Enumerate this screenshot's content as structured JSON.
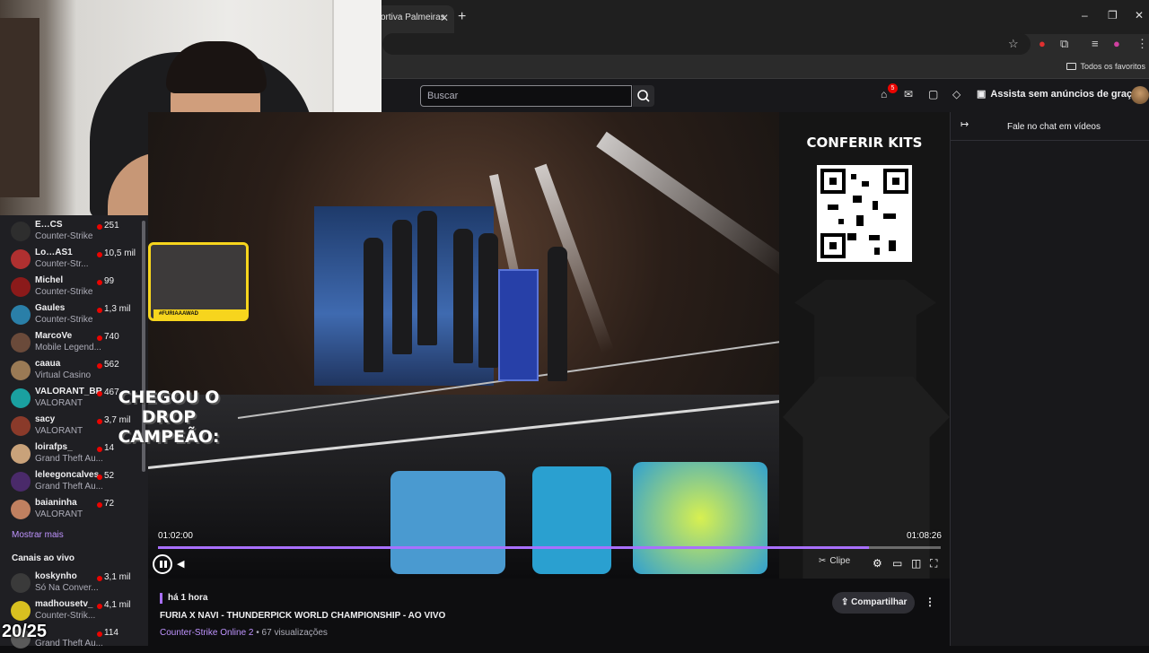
{
  "browser": {
    "tab_title": "ortiva Palmeiras",
    "tab_close": "✕",
    "new_tab": "+",
    "window_controls": [
      "–",
      "❐",
      "✕"
    ],
    "bookmarks_all": "Todos os favoritos"
  },
  "topnav": {
    "search_placeholder": "Buscar",
    "notifications_count": "5",
    "ad_free_label": "Assista sem anúncios de graça",
    "icons": [
      "search-icon",
      "prime-icon",
      "mail-icon",
      "whispers-icon",
      "crown-icon"
    ]
  },
  "sidebar": {
    "followed": [
      {
        "name": "E…CS",
        "game": "Counter-Strike",
        "viewers": "251",
        "color": "#2e2e2e"
      },
      {
        "name": "Lo…AS1",
        "game": "Counter-Str...",
        "viewers": "10,5 mil",
        "color": "#b03030"
      },
      {
        "name": "Michel",
        "game": "Counter-Strike",
        "viewers": "99",
        "color": "#8b1a1a"
      },
      {
        "name": "Gaules",
        "game": "Counter-Strike",
        "viewers": "1,3 mil",
        "color": "#2a7fa8"
      },
      {
        "name": "MarcoVe",
        "game": "Mobile Legend...",
        "viewers": "740",
        "color": "#6a4a3a"
      },
      {
        "name": "caaua",
        "game": "Virtual Casino",
        "viewers": "562",
        "color": "#9a7a55"
      },
      {
        "name": "VALORANT_BR",
        "game": "VALORANT",
        "viewers": "467",
        "color": "#1aa0a0"
      },
      {
        "name": "sacy",
        "game": "VALORANT",
        "viewers": "3,7 mil",
        "color": "#8a3a2a"
      },
      {
        "name": "loirafps_",
        "game": "Grand Theft Au...",
        "viewers": "14",
        "color": "#c9a27a"
      },
      {
        "name": "leleegoncalves",
        "game": "Grand Theft Au...",
        "viewers": "52",
        "color": "#4a2a6a"
      },
      {
        "name": "baianinha",
        "game": "VALORANT",
        "viewers": "72",
        "color": "#c08060"
      }
    ],
    "show_more": "Mostrar mais",
    "live_heading": "Canais ao vivo",
    "live": [
      {
        "name": "koskynho",
        "game": "Só Na Conver...",
        "viewers": "3,1 mil",
        "color": "#3a3a3a"
      },
      {
        "name": "madhousetv_",
        "game": "Counter-Strik...",
        "viewers": "4,1 mil",
        "color": "#d8c020"
      },
      {
        "name": "",
        "game": "Grand Theft Au...",
        "viewers": "114",
        "color": "#5a5a5a"
      }
    ]
  },
  "overlay": {
    "counter": "20/25",
    "inset_tag": "#FURIAAAWAD"
  },
  "video": {
    "drop_text": "CHEGOU O DROP CAMPEÃO:",
    "kits_title": "CONFERIR KITS",
    "time_current": "01:02:00",
    "time_end": "01:08:26",
    "progress": 0.908,
    "clip_label": "Clipe",
    "accent": "#a970ff"
  },
  "info": {
    "since": "há 1 hora",
    "title": "FURIA X NAVI - THUNDERPICK WORLD CHAMPIONSHIP - AO VIVO",
    "game": "Counter-Strike Online 2",
    "views": " • 67 visualizações",
    "share_label": "Compartilhar"
  },
  "chat": {
    "title": "Fale no chat em vídeos"
  }
}
